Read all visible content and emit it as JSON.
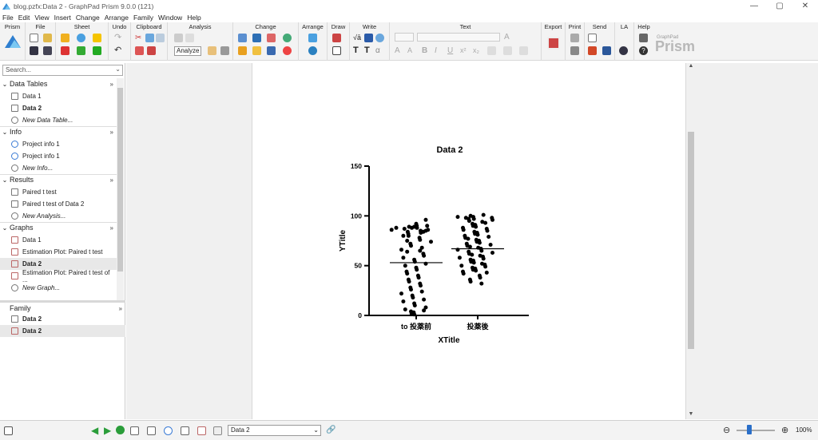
{
  "window": {
    "title": "blog.pzfx:Data 2 - GraphPad Prism 9.0.0 (121)",
    "min_label": "—",
    "max_label": "▢",
    "close_label": "✕"
  },
  "menu": [
    "File",
    "Edit",
    "View",
    "Insert",
    "Change",
    "Arrange",
    "Family",
    "Window",
    "Help"
  ],
  "ribbon": {
    "groups": [
      "Prism",
      "File",
      "Sheet",
      "Undo",
      "Clipboard",
      "Analysis",
      "Change",
      "Arrange",
      "Draw",
      "Write",
      "Text",
      "Export",
      "Print",
      "Send",
      "LA",
      "Help"
    ],
    "analyze_label": "Analyze",
    "logo_text": "Prism",
    "logo_small": "GraphPad"
  },
  "sidebar": {
    "search_placeholder": "Search...",
    "sections": [
      {
        "title": "Data Tables",
        "items": [
          "Data 1",
          "Data 2",
          "New Data Table..."
        ]
      },
      {
        "title": "Info",
        "items": [
          "Project info 1",
          "Project info 1",
          "New Info..."
        ]
      },
      {
        "title": "Results",
        "items": [
          "Paired t test",
          "Paired t test of Data 2",
          "New Analysis..."
        ]
      },
      {
        "title": "Graphs",
        "items": [
          "Data 1",
          "Estimation Plot: Paired t test",
          "Data 2",
          "Estimation Plot: Paired t test of ...",
          "New Graph..."
        ]
      }
    ],
    "family": {
      "title": "Family",
      "items": [
        "Data 2",
        "Data 2"
      ]
    }
  },
  "statusbar": {
    "sheet_selected": "Data 2",
    "zoom": "100%"
  },
  "chart_data": {
    "type": "scatter",
    "title": "Data 2",
    "xlabel": "XTitle",
    "ylabel": "YTitle",
    "categories": [
      "to 投薬前",
      "投薬後"
    ],
    "ylim": [
      0,
      150
    ],
    "yticks": [
      0,
      50,
      100,
      150
    ],
    "series": [
      {
        "category": "to 投薬前",
        "mean": 53,
        "values": [
          96,
          92,
          90,
          90,
          89,
          89,
          88,
          88,
          88,
          87,
          86,
          86,
          85,
          85,
          84,
          84,
          83,
          82,
          80,
          80,
          78,
          76,
          75,
          74,
          72,
          70,
          68,
          66,
          65,
          64,
          62,
          60,
          58,
          56,
          54,
          52,
          50,
          48,
          46,
          44,
          42,
          40,
          38,
          36,
          34,
          32,
          30,
          28,
          26,
          24,
          22,
          20,
          18,
          16,
          14,
          12,
          10,
          8,
          6,
          5,
          4,
          3,
          2,
          1
        ]
      },
      {
        "category": "投薬後",
        "mean": 67,
        "values": [
          101,
          100,
          99,
          99,
          98,
          98,
          97,
          97,
          96,
          95,
          94,
          93,
          92,
          91,
          90,
          89,
          88,
          87,
          86,
          85,
          84,
          83,
          82,
          81,
          80,
          79,
          78,
          77,
          76,
          75,
          74,
          73,
          72,
          71,
          70,
          69,
          68,
          67,
          66,
          65,
          64,
          63,
          62,
          61,
          60,
          59,
          58,
          57,
          56,
          55,
          54,
          53,
          52,
          51,
          50,
          49,
          48,
          47,
          46,
          45,
          44,
          43,
          42,
          40,
          38,
          36,
          34,
          32
        ]
      }
    ]
  }
}
